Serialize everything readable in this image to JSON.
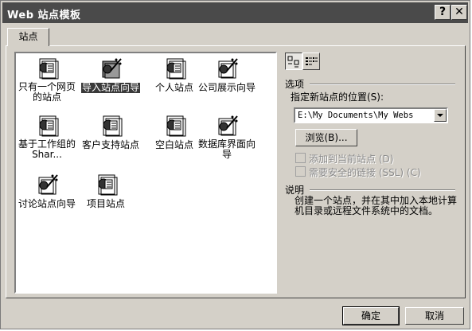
{
  "window": {
    "title": "Web 站点模板",
    "help_btn": "?",
    "close_btn": "✕"
  },
  "tab": {
    "label": "站点"
  },
  "templates": [
    {
      "label": "只有一个网页的站点",
      "icon": "single-page-icon",
      "selected": false
    },
    {
      "label": "导入站点向导",
      "icon": "wizard-icon",
      "selected": true
    },
    {
      "label": "个人站点",
      "icon": "web-page-icon",
      "selected": false
    },
    {
      "label": "公司展示向导",
      "icon": "wizard-icon",
      "selected": false
    },
    {
      "label": "基于工作组的 Shar...",
      "icon": "web-page-icon",
      "selected": false
    },
    {
      "label": "客户支持站点",
      "icon": "web-page-icon",
      "selected": false
    },
    {
      "label": "空白站点",
      "icon": "web-page-icon",
      "selected": false
    },
    {
      "label": "数据库界面向导",
      "icon": "wizard-icon",
      "selected": false
    },
    {
      "label": "讨论站点向导",
      "icon": "wizard-icon",
      "selected": false
    },
    {
      "label": "项目站点",
      "icon": "web-page-icon",
      "selected": false
    }
  ],
  "options": {
    "heading": "选项",
    "location_label": "指定新站点的位置(S):",
    "location_value": "E:\\My Documents\\My Webs",
    "browse_label": "浏览(B)...",
    "add_current_label": "添加到当前站点 (D)",
    "add_current_checked": false,
    "secure_label": "需要安全的链接 (SSL) (C)",
    "secure_checked": false
  },
  "description": {
    "heading": "说明",
    "text": "创建一个站点，并在其中加入本地计算机目录或远程文件系统中的文档。"
  },
  "buttons": {
    "ok": "确定",
    "cancel": "取消"
  }
}
